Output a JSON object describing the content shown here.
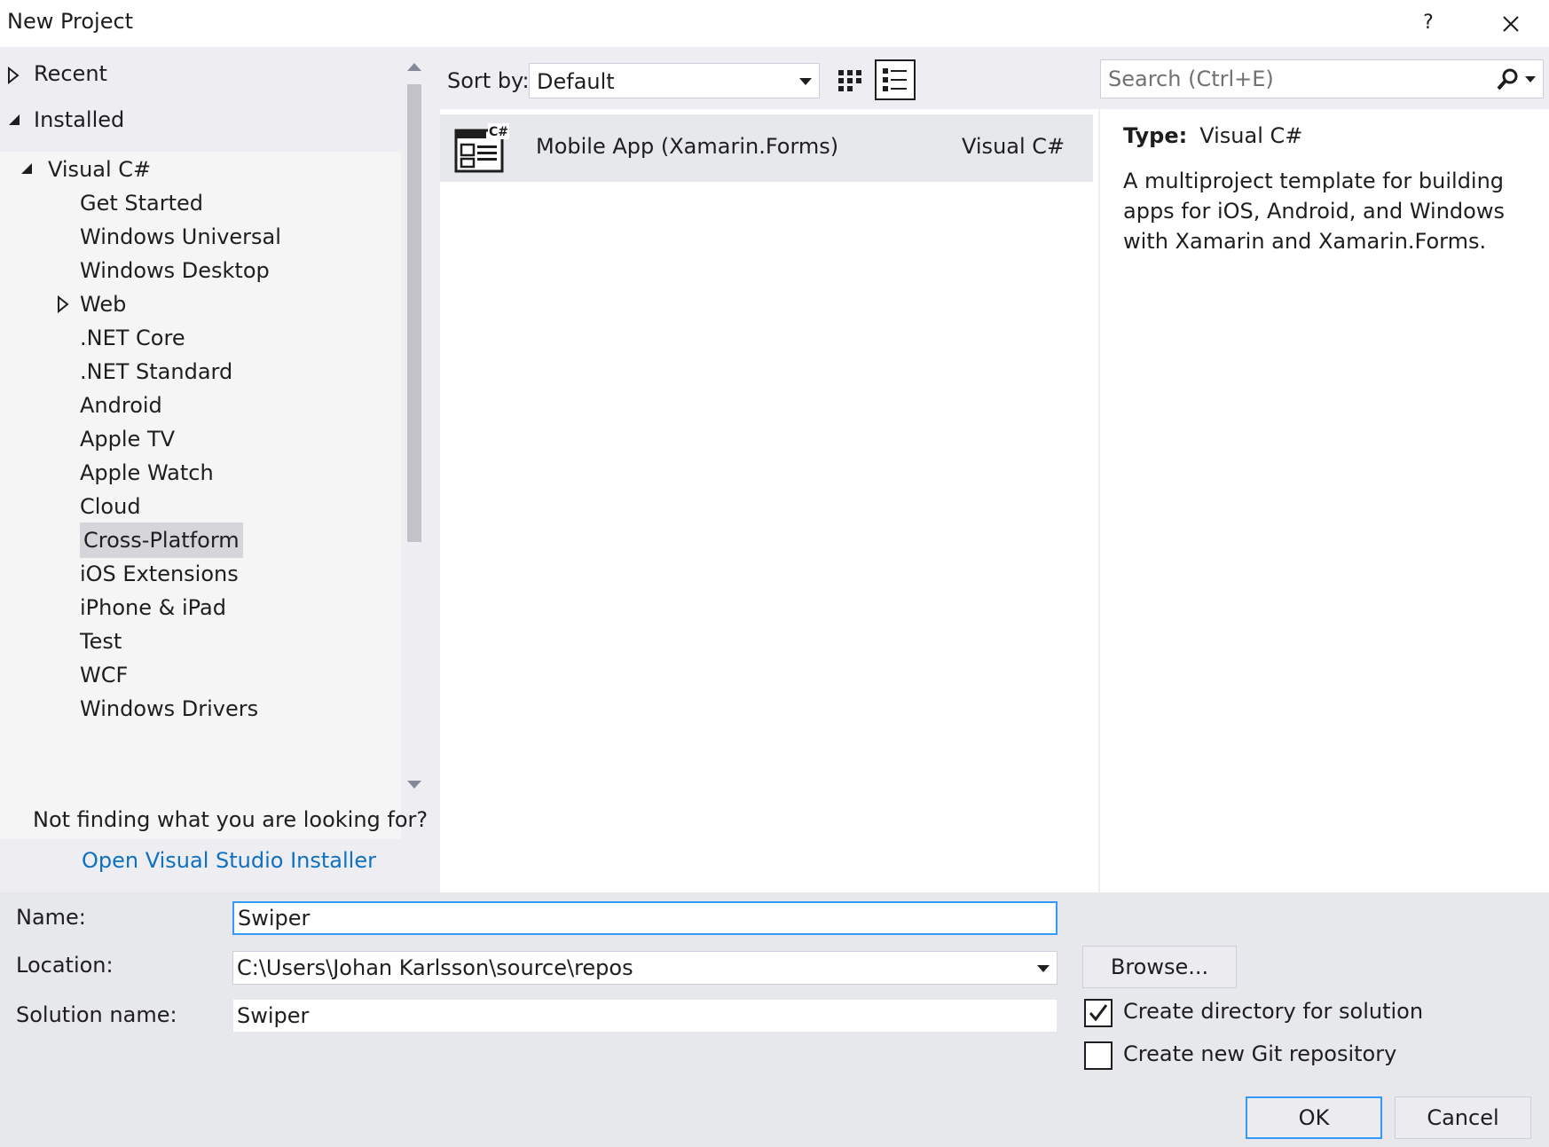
{
  "window": {
    "title": "New Project",
    "help_label": "?"
  },
  "tree": {
    "recent_label": "Recent",
    "installed_label": "Installed",
    "visual_csharp_label": "Visual C#",
    "children": [
      {
        "label": "Get Started",
        "expandable": false
      },
      {
        "label": "Windows Universal",
        "expandable": false
      },
      {
        "label": "Windows Desktop",
        "expandable": false
      },
      {
        "label": "Web",
        "expandable": true
      },
      {
        "label": ".NET Core",
        "expandable": false
      },
      {
        "label": ".NET Standard",
        "expandable": false
      },
      {
        "label": "Android",
        "expandable": false
      },
      {
        "label": "Apple TV",
        "expandable": false
      },
      {
        "label": "Apple Watch",
        "expandable": false
      },
      {
        "label": "Cloud",
        "expandable": false
      },
      {
        "label": "Cross-Platform",
        "expandable": false,
        "selected": true
      },
      {
        "label": "iOS Extensions",
        "expandable": false
      },
      {
        "label": "iPhone & iPad",
        "expandable": false
      },
      {
        "label": "Test",
        "expandable": false
      },
      {
        "label": "WCF",
        "expandable": false
      },
      {
        "label": "Windows Drivers",
        "expandable": false
      }
    ]
  },
  "not_finding": {
    "text": "Not finding what you are looking for?",
    "link": "Open Visual Studio Installer"
  },
  "sort": {
    "label": "Sort by:",
    "selected": "Default"
  },
  "templates": [
    {
      "name": "Mobile App (Xamarin.Forms)",
      "language": "Visual C#",
      "icon_badge": "C#",
      "selected": true
    }
  ],
  "search": {
    "placeholder": "Search (Ctrl+E)"
  },
  "details": {
    "type_label": "Type:",
    "type_value": "Visual C#",
    "description": "A multiproject template for building apps for iOS, Android, and Windows with Xamarin and Xamarin.Forms."
  },
  "form": {
    "name_label": "Name:",
    "name_value": "Swiper",
    "location_label": "Location:",
    "location_value": "C:\\Users\\Johan Karlsson\\source\\repos",
    "solution_label": "Solution name:",
    "solution_value": "Swiper",
    "browse_label": "Browse...",
    "create_directory_label": "Create directory for solution",
    "create_directory_checked": true,
    "git_label": "Create new Git repository",
    "git_checked": false,
    "ok_label": "OK",
    "cancel_label": "Cancel"
  },
  "colors": {
    "accent": "#3399ff",
    "link": "#0e70c0",
    "panel_bg": "#eeeef2",
    "selected_item_bg": "#d6d6da"
  },
  "icons": {
    "expand_collapsed": "triangle-right-icon",
    "expand_open": "triangle-down-right-icon",
    "search": "magnifier-icon",
    "view_small": "grid-icon",
    "view_list": "list-icon"
  }
}
